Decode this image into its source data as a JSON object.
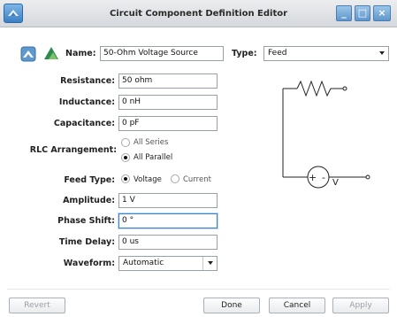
{
  "window": {
    "title": "Circuit Component Definition Editor",
    "min_glyph": "_",
    "max_glyph": "□",
    "close_glyph": "×"
  },
  "header": {
    "name_label": "Name:",
    "name_value": "50-Ohm Voltage Source",
    "type_label": "Type:",
    "type_value": "Feed"
  },
  "form": {
    "resistance_label": "Resistance:",
    "resistance_value": "50 ohm",
    "inductance_label": "Inductance:",
    "inductance_value": "0 nH",
    "capacitance_label": "Capacitance:",
    "capacitance_value": "0 pF",
    "rlc_label": "RLC Arrangement:",
    "rlc_options": [
      "All Series",
      "All Parallel"
    ],
    "rlc_selected": "All Parallel",
    "feed_type_label": "Feed Type:",
    "feed_type_options": [
      "Voltage",
      "Current"
    ],
    "feed_type_selected": "Voltage",
    "amplitude_label": "Amplitude:",
    "amplitude_value": "1 V",
    "phase_shift_label": "Phase Shift:",
    "phase_shift_value": "0 °",
    "time_delay_label": "Time Delay:",
    "time_delay_value": "0 us",
    "waveform_label": "Waveform:",
    "waveform_value": "Automatic"
  },
  "schematic": {
    "source_plus": "+",
    "source_minus": "-",
    "voltage_symbol": "V"
  },
  "buttons": {
    "revert": "Revert",
    "done": "Done",
    "cancel": "Cancel",
    "apply": "Apply"
  },
  "colors": {
    "titlebar": "#dfe1e5",
    "window_buttons": "#6fa3d6",
    "focus_border": "#3a86d6",
    "logo_green": "#3aa55c"
  }
}
